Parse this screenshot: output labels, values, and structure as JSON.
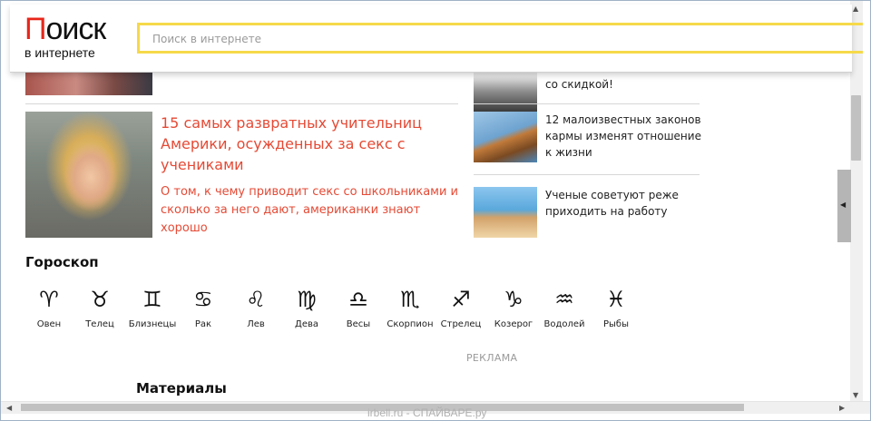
{
  "header": {
    "logo_main": "Поиск",
    "logo_sub": "в интернете",
    "search_placeholder": "Поиск в интернете",
    "brand_color": "#e8261a",
    "search_border_color": "#f6d94a"
  },
  "main_article": {
    "title": "15 самых развратных учительниц Америки, осужденных за секс с учениками",
    "description": "О том, к чему приводит секс со школьниками и сколько за него дают, американки знают хорошо",
    "accent_color": "#e54a35"
  },
  "side_articles": [
    {
      "title": "со скидкой!"
    },
    {
      "title": "12 малоизвестных законов кармы изменят отношение к жизни"
    },
    {
      "title": "Ученые советуют реже приходить на работу"
    }
  ],
  "horoscope": {
    "title": "Гороскоп",
    "signs": [
      {
        "glyph": "♈",
        "name": "Овен"
      },
      {
        "glyph": "♉",
        "name": "Телец"
      },
      {
        "glyph": "♊",
        "name": "Близнецы"
      },
      {
        "glyph": "♋",
        "name": "Рак"
      },
      {
        "glyph": "♌",
        "name": "Лев"
      },
      {
        "glyph": "♍",
        "name": "Дева"
      },
      {
        "glyph": "♎",
        "name": "Весы"
      },
      {
        "glyph": "♏",
        "name": "Скорпион"
      },
      {
        "glyph": "♐",
        "name": "Стрелец"
      },
      {
        "glyph": "♑",
        "name": "Козерог"
      },
      {
        "glyph": "♒",
        "name": "Водолей"
      },
      {
        "glyph": "♓",
        "name": "Рыбы"
      }
    ]
  },
  "ad_label": "РЕКЛАМА",
  "materials_title": "Материалы",
  "watermark": "irbell.ru - СПАЙВАРЕ.ру"
}
